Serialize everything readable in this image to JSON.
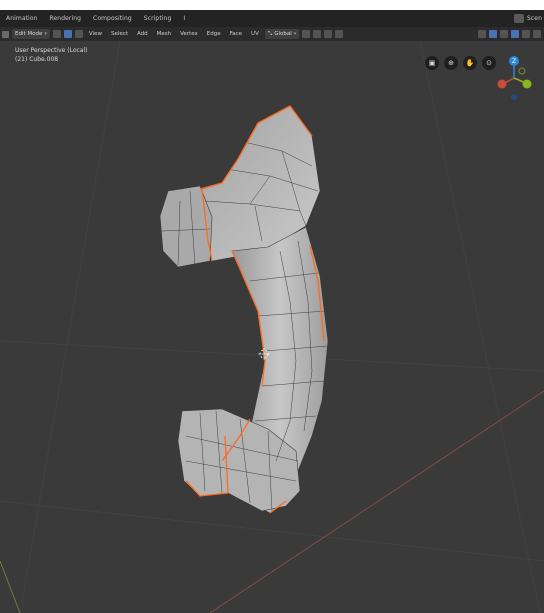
{
  "workspace_tabs": [
    "Animation",
    "Rendering",
    "Compositing",
    "Scripting",
    "I"
  ],
  "scene_label": "Scen",
  "viewport_header": {
    "mode": "Edit Mode",
    "menus": [
      "View",
      "Select",
      "Add",
      "Mesh",
      "Vertex",
      "Edge",
      "Face",
      "UV"
    ],
    "transform_orientation": "Global"
  },
  "view_info": {
    "perspective": "User Perspective (Local)",
    "object": "(21) Cube.008"
  },
  "nav_buttons": {
    "camera": "▣",
    "zoom": "⊕",
    "pan": "✋",
    "ortho": "⊙"
  },
  "gizmo": {
    "x": "X",
    "y": "Y",
    "z": "Z"
  },
  "colors": {
    "viewport_bg": "#3a3a3a",
    "header_bg": "#2b2b2b",
    "edge_selected": "#ff7a2a",
    "mesh_face": "#b9b9b9",
    "axis_x": "#c94b3a",
    "axis_y": "#8ab521",
    "axis_z": "#2c86d8"
  }
}
